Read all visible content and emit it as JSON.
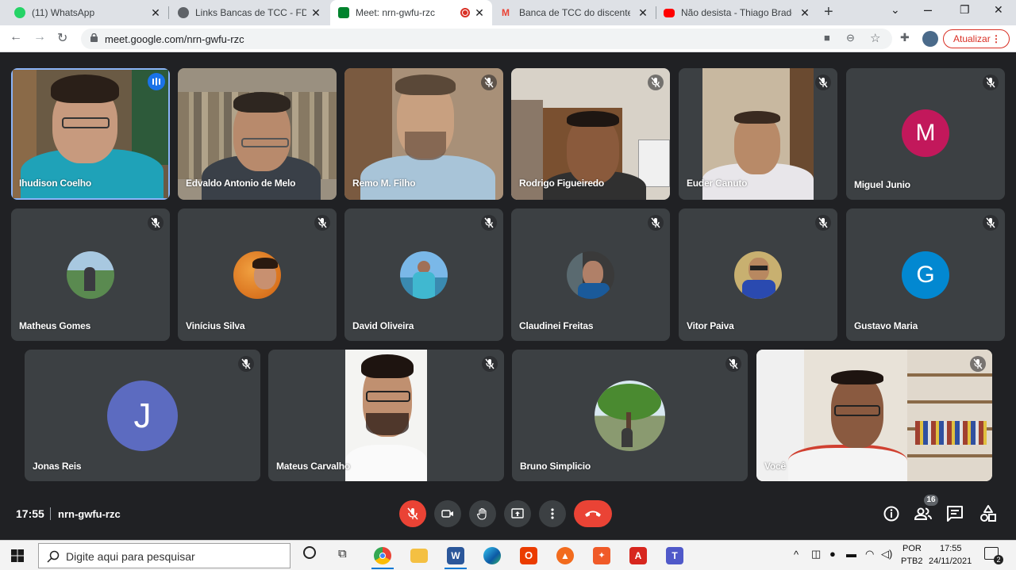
{
  "browser": {
    "tabs": [
      {
        "title": "(11) WhatsApp",
        "favicon_color": "#25d366",
        "badge": "11",
        "active": false
      },
      {
        "title": "Links Bancas de TCC - FDLM",
        "favicon_color": "#5f6368",
        "active": false
      },
      {
        "title": "Meet: nrn-gwfu-rzc",
        "favicon_color": "#00832d",
        "active": true,
        "recording": true
      },
      {
        "title": "Banca de TCC do discente N",
        "favicon_color": "#ea4335",
        "active": false
      },
      {
        "title": "Não desista - Thiago Brado (",
        "favicon_color": "#ff0000",
        "active": false
      }
    ],
    "url": "meet.google.com/nrn-gwfu-rzc",
    "update_label": "Atualizar"
  },
  "meet": {
    "accent": "#8ab4f8",
    "participants": [
      {
        "name": "Ihudison Coelho",
        "type": "video",
        "speaking": true
      },
      {
        "name": "Edvaldo Antonio de Melo",
        "type": "video",
        "muted": false
      },
      {
        "name": "Remo M. Filho",
        "type": "video",
        "muted": true
      },
      {
        "name": "Rodrigo Figueiredo",
        "type": "video",
        "muted": true
      },
      {
        "name": "Euder Canuto",
        "type": "video",
        "muted": true
      },
      {
        "name": "Miguel Junio",
        "type": "letter",
        "letter": "M",
        "color": "#c2185b",
        "muted": true
      },
      {
        "name": "Matheus Gomes",
        "type": "photo",
        "muted": true
      },
      {
        "name": "Vinícius Silva",
        "type": "photo",
        "muted": true
      },
      {
        "name": "David Oliveira",
        "type": "photo",
        "muted": true
      },
      {
        "name": "Claudinei Freitas",
        "type": "photo",
        "muted": true
      },
      {
        "name": "Vitor Paiva",
        "type": "photo",
        "muted": true
      },
      {
        "name": "Gustavo Maria",
        "type": "letter",
        "letter": "G",
        "color": "#0288d1",
        "muted": true
      },
      {
        "name": "Jonas Reis",
        "type": "letter",
        "letter": "J",
        "color": "#5c6bc0",
        "muted": true
      },
      {
        "name": "Mateus Carvalho",
        "type": "video",
        "muted": true
      },
      {
        "name": "Bruno Simplicio",
        "type": "photo",
        "muted": true
      },
      {
        "name": "Você",
        "type": "video",
        "muted": true
      }
    ],
    "bottombar": {
      "time": "17:55",
      "meeting_code": "nrn-gwfu-rzc",
      "people_count": "16"
    }
  },
  "taskbar": {
    "search_placeholder": "Digite aqui para pesquisar",
    "language": "POR",
    "keyboard": "PTB2",
    "time": "17:55",
    "date": "24/11/2021",
    "notifications": "2"
  }
}
